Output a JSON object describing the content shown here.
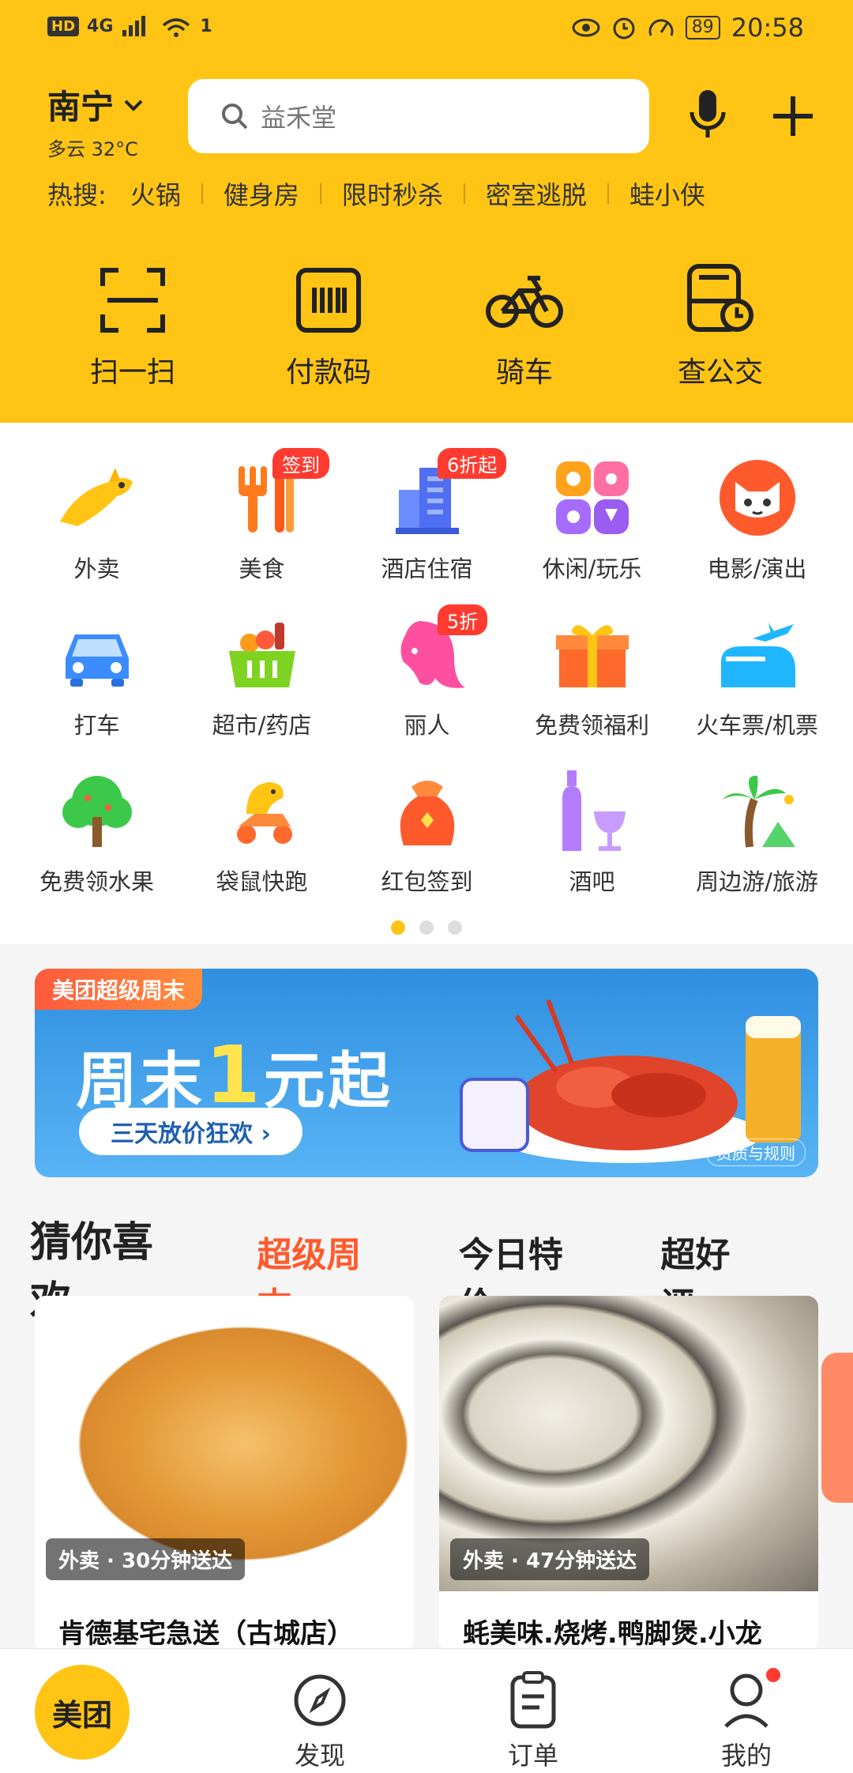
{
  "status_bar": {
    "hd": "HD",
    "net": "4G",
    "signal_num": "1",
    "battery": "89",
    "time": "20:58"
  },
  "header": {
    "city": "南宁",
    "weather": "多云 32°C",
    "search_placeholder": "益禾堂"
  },
  "hot": {
    "label": "热搜:",
    "items": [
      "火锅",
      "健身房",
      "限时秒杀",
      "密室逃脱",
      "蛙小侠"
    ]
  },
  "quick_actions": [
    {
      "label": "扫一扫"
    },
    {
      "label": "付款码"
    },
    {
      "label": "骑车"
    },
    {
      "label": "查公交"
    }
  ],
  "categories": [
    {
      "label": "外卖",
      "badge": ""
    },
    {
      "label": "美食",
      "badge": "签到"
    },
    {
      "label": "酒店住宿",
      "badge": "6折起"
    },
    {
      "label": "休闲/玩乐",
      "badge": ""
    },
    {
      "label": "电影/演出",
      "badge": ""
    },
    {
      "label": "打车",
      "badge": ""
    },
    {
      "label": "超市/药店",
      "badge": ""
    },
    {
      "label": "丽人",
      "badge": "5折"
    },
    {
      "label": "免费领福利",
      "badge": ""
    },
    {
      "label": "火车票/机票",
      "badge": ""
    },
    {
      "label": "免费领水果",
      "badge": ""
    },
    {
      "label": "袋鼠快跑",
      "badge": ""
    },
    {
      "label": "红包签到",
      "badge": ""
    },
    {
      "label": "酒吧",
      "badge": ""
    },
    {
      "label": "周边游/旅游",
      "badge": ""
    }
  ],
  "banner": {
    "tag": "美团超级周末",
    "headline_a": "周末",
    "headline_num": "1",
    "headline_b": "元起",
    "pill": "三天放价狂欢 ›",
    "rules": "资质与规则"
  },
  "feed_tabs": [
    {
      "label": "猜你喜欢"
    },
    {
      "label": "超级周末"
    },
    {
      "label": "今日特价"
    },
    {
      "label": "超好评"
    }
  ],
  "cards": [
    {
      "tag": "外卖 · 30分钟送达",
      "title": "肯德基宅急送（古城店）"
    },
    {
      "tag": "外卖 · 47分钟送达",
      "title": "蚝美味.烧烤.鸭脚煲.小龙"
    }
  ],
  "bottom_nav": [
    {
      "label": "美团"
    },
    {
      "label": "发现"
    },
    {
      "label": "订单"
    },
    {
      "label": "我的"
    }
  ],
  "colors": {
    "brand_yellow": "#ffc414",
    "badge_red": "#ff3b30",
    "tab_red": "#ff5a2c"
  }
}
